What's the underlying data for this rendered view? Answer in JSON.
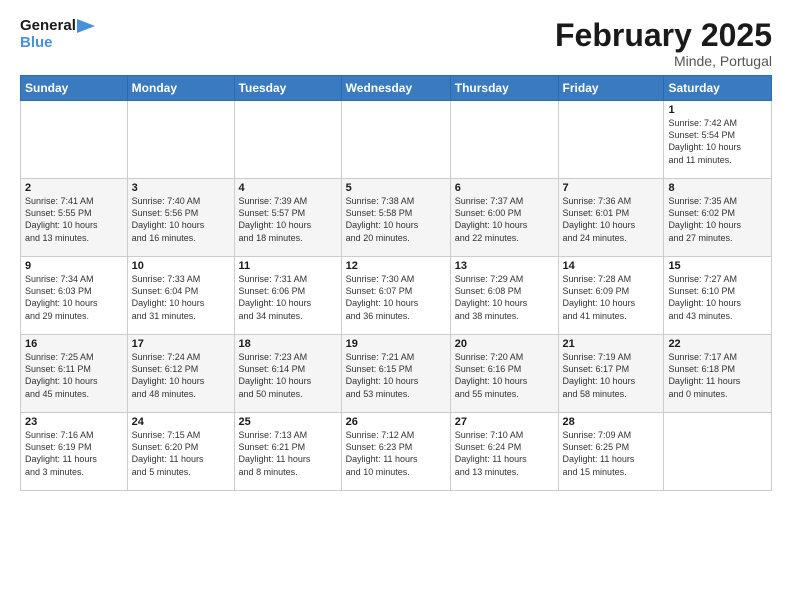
{
  "header": {
    "logo_line1": "General",
    "logo_line2": "Blue",
    "title": "February 2025",
    "location": "Minde, Portugal"
  },
  "weekdays": [
    "Sunday",
    "Monday",
    "Tuesday",
    "Wednesday",
    "Thursday",
    "Friday",
    "Saturday"
  ],
  "weeks": [
    [
      {
        "day": "",
        "info": ""
      },
      {
        "day": "",
        "info": ""
      },
      {
        "day": "",
        "info": ""
      },
      {
        "day": "",
        "info": ""
      },
      {
        "day": "",
        "info": ""
      },
      {
        "day": "",
        "info": ""
      },
      {
        "day": "1",
        "info": "Sunrise: 7:42 AM\nSunset: 5:54 PM\nDaylight: 10 hours\nand 11 minutes."
      }
    ],
    [
      {
        "day": "2",
        "info": "Sunrise: 7:41 AM\nSunset: 5:55 PM\nDaylight: 10 hours\nand 13 minutes."
      },
      {
        "day": "3",
        "info": "Sunrise: 7:40 AM\nSunset: 5:56 PM\nDaylight: 10 hours\nand 16 minutes."
      },
      {
        "day": "4",
        "info": "Sunrise: 7:39 AM\nSunset: 5:57 PM\nDaylight: 10 hours\nand 18 minutes."
      },
      {
        "day": "5",
        "info": "Sunrise: 7:38 AM\nSunset: 5:58 PM\nDaylight: 10 hours\nand 20 minutes."
      },
      {
        "day": "6",
        "info": "Sunrise: 7:37 AM\nSunset: 6:00 PM\nDaylight: 10 hours\nand 22 minutes."
      },
      {
        "day": "7",
        "info": "Sunrise: 7:36 AM\nSunset: 6:01 PM\nDaylight: 10 hours\nand 24 minutes."
      },
      {
        "day": "8",
        "info": "Sunrise: 7:35 AM\nSunset: 6:02 PM\nDaylight: 10 hours\nand 27 minutes."
      }
    ],
    [
      {
        "day": "9",
        "info": "Sunrise: 7:34 AM\nSunset: 6:03 PM\nDaylight: 10 hours\nand 29 minutes."
      },
      {
        "day": "10",
        "info": "Sunrise: 7:33 AM\nSunset: 6:04 PM\nDaylight: 10 hours\nand 31 minutes."
      },
      {
        "day": "11",
        "info": "Sunrise: 7:31 AM\nSunset: 6:06 PM\nDaylight: 10 hours\nand 34 minutes."
      },
      {
        "day": "12",
        "info": "Sunrise: 7:30 AM\nSunset: 6:07 PM\nDaylight: 10 hours\nand 36 minutes."
      },
      {
        "day": "13",
        "info": "Sunrise: 7:29 AM\nSunset: 6:08 PM\nDaylight: 10 hours\nand 38 minutes."
      },
      {
        "day": "14",
        "info": "Sunrise: 7:28 AM\nSunset: 6:09 PM\nDaylight: 10 hours\nand 41 minutes."
      },
      {
        "day": "15",
        "info": "Sunrise: 7:27 AM\nSunset: 6:10 PM\nDaylight: 10 hours\nand 43 minutes."
      }
    ],
    [
      {
        "day": "16",
        "info": "Sunrise: 7:25 AM\nSunset: 6:11 PM\nDaylight: 10 hours\nand 45 minutes."
      },
      {
        "day": "17",
        "info": "Sunrise: 7:24 AM\nSunset: 6:12 PM\nDaylight: 10 hours\nand 48 minutes."
      },
      {
        "day": "18",
        "info": "Sunrise: 7:23 AM\nSunset: 6:14 PM\nDaylight: 10 hours\nand 50 minutes."
      },
      {
        "day": "19",
        "info": "Sunrise: 7:21 AM\nSunset: 6:15 PM\nDaylight: 10 hours\nand 53 minutes."
      },
      {
        "day": "20",
        "info": "Sunrise: 7:20 AM\nSunset: 6:16 PM\nDaylight: 10 hours\nand 55 minutes."
      },
      {
        "day": "21",
        "info": "Sunrise: 7:19 AM\nSunset: 6:17 PM\nDaylight: 10 hours\nand 58 minutes."
      },
      {
        "day": "22",
        "info": "Sunrise: 7:17 AM\nSunset: 6:18 PM\nDaylight: 11 hours\nand 0 minutes."
      }
    ],
    [
      {
        "day": "23",
        "info": "Sunrise: 7:16 AM\nSunset: 6:19 PM\nDaylight: 11 hours\nand 3 minutes."
      },
      {
        "day": "24",
        "info": "Sunrise: 7:15 AM\nSunset: 6:20 PM\nDaylight: 11 hours\nand 5 minutes."
      },
      {
        "day": "25",
        "info": "Sunrise: 7:13 AM\nSunset: 6:21 PM\nDaylight: 11 hours\nand 8 minutes."
      },
      {
        "day": "26",
        "info": "Sunrise: 7:12 AM\nSunset: 6:23 PM\nDaylight: 11 hours\nand 10 minutes."
      },
      {
        "day": "27",
        "info": "Sunrise: 7:10 AM\nSunset: 6:24 PM\nDaylight: 11 hours\nand 13 minutes."
      },
      {
        "day": "28",
        "info": "Sunrise: 7:09 AM\nSunset: 6:25 PM\nDaylight: 11 hours\nand 15 minutes."
      },
      {
        "day": "",
        "info": ""
      }
    ]
  ]
}
